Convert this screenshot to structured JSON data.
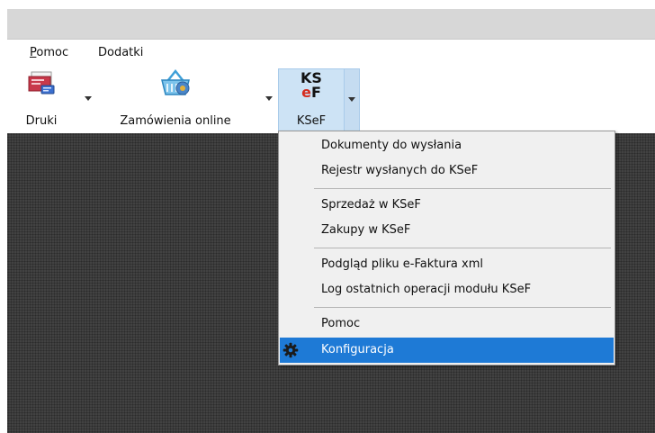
{
  "menubar": {
    "items": [
      {
        "label": "Pomoc",
        "accel": "P",
        "rest": "omoc"
      },
      {
        "label": "Dodatki"
      }
    ]
  },
  "toolbar": {
    "druki_label": "Druki",
    "zamowienia_label": "Zamówienia online",
    "ksef_label": "KSeF",
    "ksef_logo_line1": "KS",
    "ksef_logo_e": "e",
    "ksef_logo_f": "F"
  },
  "dropdown": {
    "items": [
      {
        "label": "Dokumenty do wysłania"
      },
      {
        "label": "Rejestr wysłanych do KSeF"
      },
      {
        "label": "Sprzedaż w KSeF"
      },
      {
        "label": "Zakupy w KSeF"
      },
      {
        "label": "Podgląd pliku e-Faktura xml"
      },
      {
        "label": "Log ostatnich operacji modułu KSeF"
      },
      {
        "label": "Pomoc"
      },
      {
        "label": "Konfiguracja",
        "selected": true,
        "icon": "gear-icon"
      }
    ]
  },
  "colors": {
    "selection": "#1e7ad6",
    "ksef_highlight": "#cde3f5",
    "ksef_logo_red": "#d52b1e",
    "workspace": "#3a3a3a"
  }
}
